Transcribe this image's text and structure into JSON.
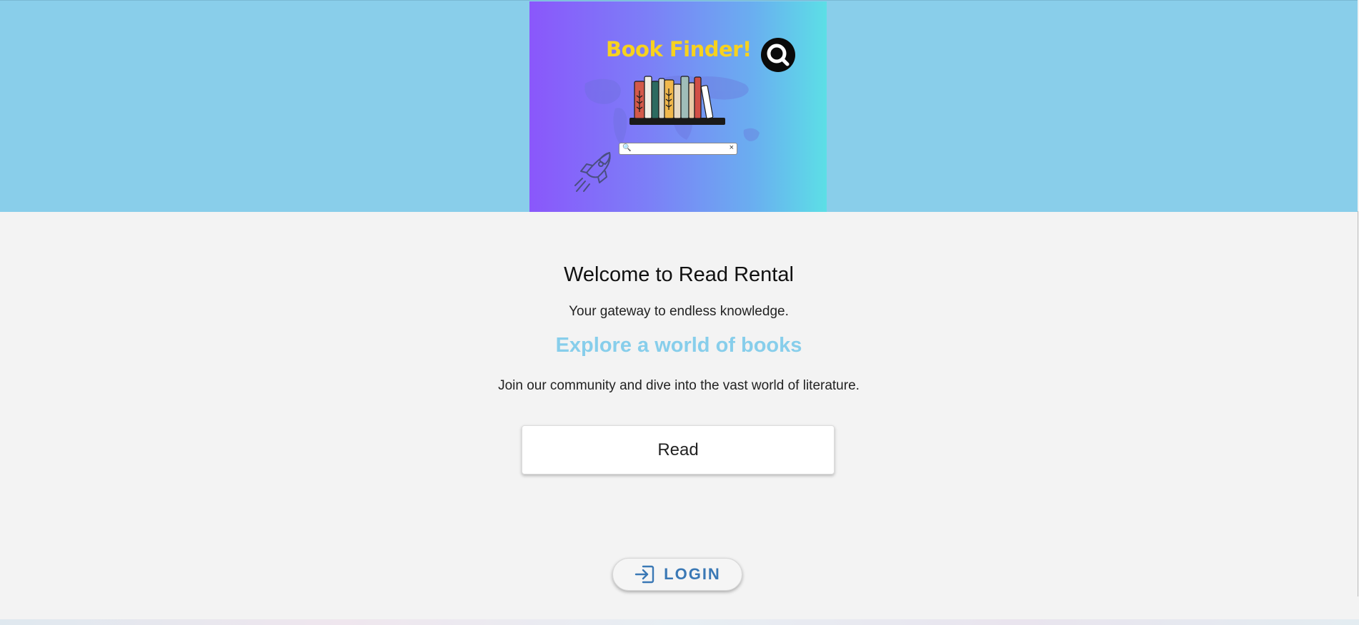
{
  "header": {
    "banner": {
      "title": "Book Finder!",
      "search_icon": "search-icon",
      "clear_icon": "close-icon",
      "clear_symbol": "×"
    }
  },
  "main": {
    "heading": "Welcome to Read Rental",
    "tagline": "Your gateway to endless knowledge.",
    "subheading": "Explore a world of books",
    "description": "Join our community and dive into the vast world of literature.",
    "read_button": "Read",
    "login_button": "LOGIN"
  },
  "colors": {
    "header_background": "#89ceea",
    "page_background": "#f3f3f3",
    "accent": "#87ceeb",
    "login_text": "#3a78b5",
    "banner_title": "#f7d21f"
  }
}
